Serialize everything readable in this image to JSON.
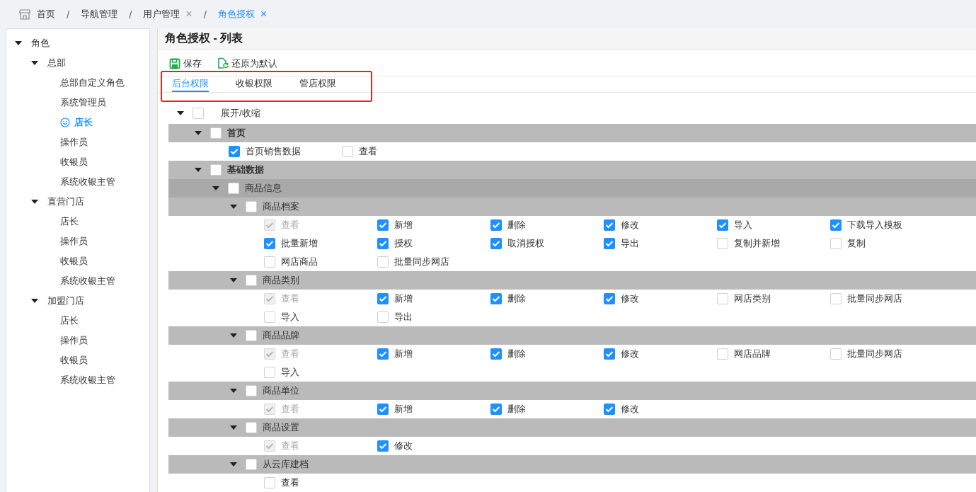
{
  "breadcrumb": [
    {
      "label": "首页",
      "kind": "home",
      "selected": false
    },
    {
      "separator": "/",
      "label": "导航管理",
      "kind": "plain",
      "selected": false
    },
    {
      "separator": "/",
      "label": "用户管理",
      "kind": "plain",
      "close": "×",
      "selected": false
    },
    {
      "separator": "/",
      "label": "角色授权",
      "kind": "plain",
      "close": "×",
      "selected": true
    }
  ],
  "sidebar": {
    "tree": [
      {
        "label": "角色",
        "expanded": true,
        "selected": false,
        "children": [
          {
            "label": "总部",
            "expanded": true,
            "selected": false,
            "children": [
              {
                "label": "总部自定义角色",
                "selected": false
              },
              {
                "label": "系统管理员",
                "selected": false
              },
              {
                "label": "店长",
                "selected": true
              },
              {
                "label": "操作员",
                "selected": false
              },
              {
                "label": "收银员",
                "selected": false
              },
              {
                "label": "系统收银主管",
                "selected": false
              }
            ]
          },
          {
            "label": "直营门店",
            "expanded": true,
            "selected": false,
            "children": [
              {
                "label": "店长",
                "selected": false
              },
              {
                "label": "操作员",
                "selected": false
              },
              {
                "label": "收银员",
                "selected": false
              },
              {
                "label": "系统收银主管",
                "selected": false
              }
            ]
          },
          {
            "label": "加盟门店",
            "expanded": true,
            "selected": false,
            "children": [
              {
                "label": "店长",
                "selected": false
              },
              {
                "label": "操作员",
                "selected": false
              },
              {
                "label": "收银员",
                "selected": false
              },
              {
                "label": "系统收银主管",
                "selected": false
              }
            ]
          }
        ]
      }
    ]
  },
  "panel": {
    "title": "角色授权 - 列表",
    "toolbar": [
      {
        "label": "保存",
        "kind": "save"
      },
      {
        "label": "还原为默认",
        "kind": "restore"
      }
    ],
    "tabs": [
      {
        "label": "后台权限",
        "selected": true
      },
      {
        "label": "收银权限",
        "selected": false
      },
      {
        "label": "管店权限",
        "selected": false
      }
    ],
    "expand_all": {
      "label": "展开/收缩",
      "checked": false,
      "expanded": true
    },
    "permission_tree": [
      {
        "label": "首页",
        "checked": false,
        "expanded": true,
        "permissions": [
          {
            "label": "首页销售数据",
            "checked": true,
            "disabled": false
          },
          {
            "label": "查看",
            "checked": false,
            "disabled": false
          }
        ]
      },
      {
        "label": "基础数据",
        "checked": false,
        "expanded": true,
        "children": [
          {
            "label": "商品信息",
            "checked": false,
            "expanded": true,
            "children": [
              {
                "label": "商品档案",
                "checked": false,
                "expanded": true,
                "permissions": [
                  {
                    "label": "查看",
                    "checked": true,
                    "disabled": true
                  },
                  {
                    "label": "新增",
                    "checked": true,
                    "disabled": false
                  },
                  {
                    "label": "删除",
                    "checked": true,
                    "disabled": false
                  },
                  {
                    "label": "修改",
                    "checked": true,
                    "disabled": false
                  },
                  {
                    "label": "导入",
                    "checked": true,
                    "disabled": false
                  },
                  {
                    "label": "下载导入模板",
                    "checked": true,
                    "disabled": false
                  },
                  {
                    "label": "批量新增",
                    "checked": true,
                    "disabled": false
                  },
                  {
                    "label": "授权",
                    "checked": true,
                    "disabled": false
                  },
                  {
                    "label": "取消授权",
                    "checked": true,
                    "disabled": false
                  },
                  {
                    "label": "导出",
                    "checked": true,
                    "disabled": false
                  },
                  {
                    "label": "复制并新增",
                    "checked": false,
                    "disabled": false
                  },
                  {
                    "label": "复制",
                    "checked": false,
                    "disabled": false
                  },
                  {
                    "label": "网店商品",
                    "checked": false,
                    "disabled": false
                  },
                  {
                    "label": "批量同步网店",
                    "checked": false,
                    "disabled": false
                  }
                ]
              },
              {
                "label": "商品类别",
                "checked": false,
                "expanded": true,
                "permissions": [
                  {
                    "label": "查看",
                    "checked": true,
                    "disabled": true
                  },
                  {
                    "label": "新增",
                    "checked": true,
                    "disabled": false
                  },
                  {
                    "label": "删除",
                    "checked": true,
                    "disabled": false
                  },
                  {
                    "label": "修改",
                    "checked": true,
                    "disabled": false
                  },
                  {
                    "label": "网店类别",
                    "checked": false,
                    "disabled": false
                  },
                  {
                    "label": "批量同步网店",
                    "checked": false,
                    "disabled": false
                  },
                  {
                    "label": "导入",
                    "checked": false,
                    "disabled": false
                  },
                  {
                    "label": "导出",
                    "checked": false,
                    "disabled": false
                  }
                ]
              },
              {
                "label": "商品品牌",
                "checked": false,
                "expanded": true,
                "permissions": [
                  {
                    "label": "查看",
                    "checked": true,
                    "disabled": true
                  },
                  {
                    "label": "新增",
                    "checked": true,
                    "disabled": false
                  },
                  {
                    "label": "删除",
                    "checked": true,
                    "disabled": false
                  },
                  {
                    "label": "修改",
                    "checked": true,
                    "disabled": false
                  },
                  {
                    "label": "网店品牌",
                    "checked": false,
                    "disabled": false
                  },
                  {
                    "label": "批量同步网店",
                    "checked": false,
                    "disabled": false
                  },
                  {
                    "label": "导入",
                    "checked": false,
                    "disabled": false
                  }
                ]
              },
              {
                "label": "商品单位",
                "checked": false,
                "expanded": true,
                "permissions": [
                  {
                    "label": "查看",
                    "checked": true,
                    "disabled": true
                  },
                  {
                    "label": "新增",
                    "checked": true,
                    "disabled": false
                  },
                  {
                    "label": "删除",
                    "checked": true,
                    "disabled": false
                  },
                  {
                    "label": "修改",
                    "checked": true,
                    "disabled": false
                  }
                ]
              },
              {
                "label": "商品设置",
                "checked": false,
                "expanded": true,
                "permissions": [
                  {
                    "label": "查看",
                    "checked": true,
                    "disabled": true
                  },
                  {
                    "label": "修改",
                    "checked": true,
                    "disabled": false
                  }
                ]
              },
              {
                "label": "从云库建档",
                "checked": false,
                "expanded": true,
                "permissions": [
                  {
                    "label": "查看",
                    "checked": false,
                    "disabled": false
                  }
                ]
              }
            ]
          }
        ]
      }
    ]
  }
}
